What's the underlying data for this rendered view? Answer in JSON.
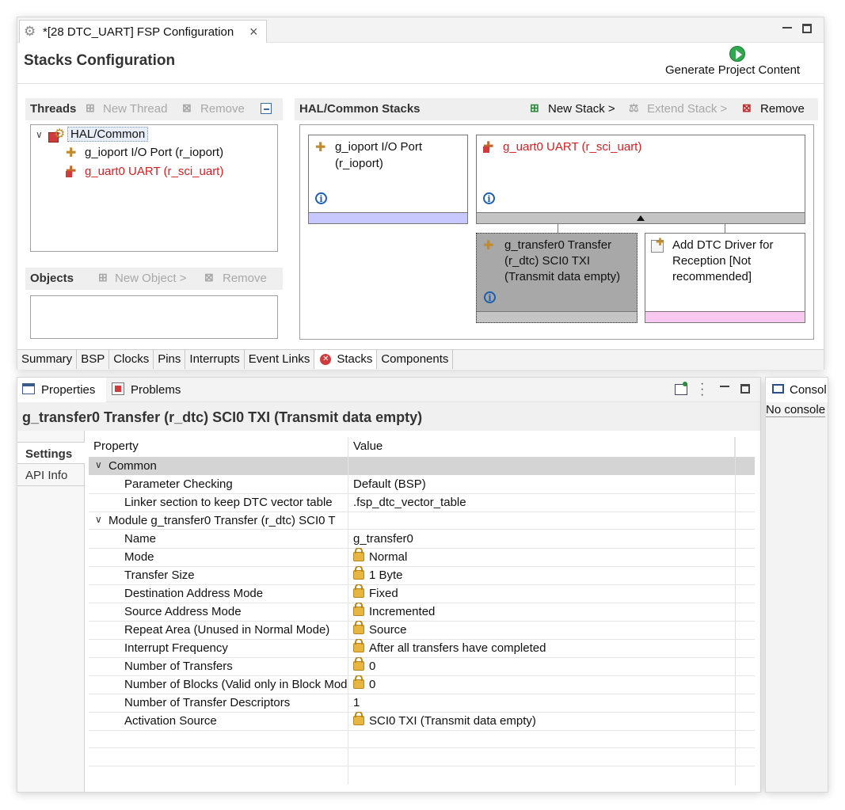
{
  "editor_tab": {
    "title": "*[28 DTC_UART] FSP Configuration",
    "close": "×"
  },
  "page_title": "Stacks Configuration",
  "generate_label": "Generate Project Content",
  "threads": {
    "header": "Threads",
    "new_thread": "New Thread",
    "remove": "Remove",
    "tree": [
      {
        "label": "HAL/Common",
        "expanded": true
      },
      {
        "label": "g_ioport I/O Port (r_ioport)"
      },
      {
        "label": "g_uart0 UART (r_sci_uart)",
        "error": true
      }
    ]
  },
  "objects": {
    "header": "Objects",
    "new_object": "New Object >",
    "remove": "Remove"
  },
  "hal_stacks": {
    "header": "HAL/Common Stacks",
    "new_stack": "New Stack >",
    "extend_stack": "Extend Stack >",
    "remove": "Remove",
    "blocks": {
      "ioport_line1": "g_ioport I/O Port",
      "ioport_line2": "(r_ioport)",
      "uart": "g_uart0 UART (r_sci_uart)",
      "transfer_line1": "g_transfer0 Transfer",
      "transfer_line2": "(r_dtc) SCI0 TXI",
      "transfer_line3": "(Transmit data empty)",
      "dtc_line1": "Add DTC Driver for",
      "dtc_line2": "Reception [Not",
      "dtc_line3": "recommended]"
    }
  },
  "config_tabs": [
    "Summary",
    "BSP",
    "Clocks",
    "Pins",
    "Interrupts",
    "Event Links",
    "Stacks",
    "Components"
  ],
  "views": {
    "properties": "Properties",
    "problems": "Problems",
    "console": "Consol",
    "console_body": "No console"
  },
  "prop_title": "g_transfer0 Transfer (r_dtc) SCI0 TXI (Transmit data empty)",
  "side_tabs": {
    "settings": "Settings",
    "api_info": "API Info"
  },
  "table": {
    "col_property": "Property",
    "col_value": "Value",
    "group_common": "Common",
    "group_module": "Module g_transfer0 Transfer (r_dtc) SCI0 T",
    "rows": [
      {
        "prop": "Parameter Checking",
        "value": "Default (BSP)",
        "locked": false,
        "group": "common"
      },
      {
        "prop": "Linker section to keep DTC vector table",
        "value": ".fsp_dtc_vector_table",
        "locked": false,
        "group": "common"
      },
      {
        "prop": "Name",
        "value": "g_transfer0",
        "locked": false
      },
      {
        "prop": "Mode",
        "value": "Normal",
        "locked": true
      },
      {
        "prop": "Transfer Size",
        "value": "1 Byte",
        "locked": true
      },
      {
        "prop": "Destination Address Mode",
        "value": "Fixed",
        "locked": true
      },
      {
        "prop": "Source Address Mode",
        "value": "Incremented",
        "locked": true
      },
      {
        "prop": "Repeat Area (Unused in Normal Mode)",
        "value": "Source",
        "locked": true
      },
      {
        "prop": "Interrupt Frequency",
        "value": "After all transfers have completed",
        "locked": true
      },
      {
        "prop": "Number of Transfers",
        "value": "0",
        "locked": true
      },
      {
        "prop": "Number of Blocks (Valid only in Block Mode)",
        "value": "0",
        "locked": true
      },
      {
        "prop": "Number of Transfer Descriptors",
        "value": "1",
        "locked": false
      },
      {
        "prop": "Activation Source",
        "value": "SCI0 TXI (Transmit data empty)",
        "locked": true
      }
    ]
  }
}
